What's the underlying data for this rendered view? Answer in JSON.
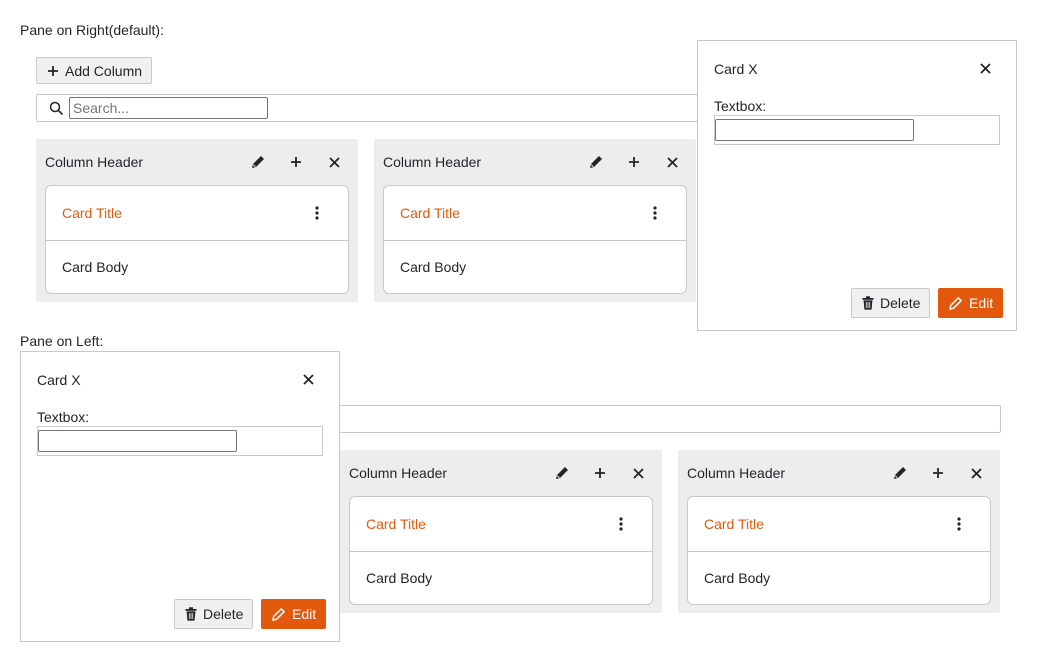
{
  "colors": {
    "accent": "#e3580c",
    "column_bg": "#ededed",
    "border": "#c9c9c9"
  },
  "icons": {
    "add": "plus-icon",
    "search": "search-icon",
    "edit": "pencil-icon",
    "close": "close-icon",
    "more": "kebab-icon",
    "delete": "trash-icon"
  },
  "right_demo": {
    "label": "Pane on Right(default):",
    "toolbar": {
      "add_column_label": "Add Column"
    },
    "search": {
      "placeholder": "Search...",
      "value": ""
    },
    "columns": [
      {
        "header": "Column Header",
        "cards": [
          {
            "title": "Card Title",
            "body": "Card Body"
          }
        ]
      },
      {
        "header": "Column Header",
        "cards": [
          {
            "title": "Card Title",
            "body": "Card Body"
          }
        ]
      }
    ],
    "pane": {
      "title": "Card X",
      "textbox_label": "Textbox:",
      "textbox_value": "",
      "delete_label": "Delete",
      "edit_label": "Edit"
    }
  },
  "left_demo": {
    "label": "Pane on Left:",
    "columns": [
      {
        "header": "Column Header",
        "cards": [
          {
            "title": "Card Title",
            "body": "Card Body"
          }
        ]
      },
      {
        "header": "Column Header",
        "cards": [
          {
            "title": "Card Title",
            "body": "Card Body"
          }
        ]
      }
    ],
    "pane": {
      "title": "Card X",
      "textbox_label": "Textbox:",
      "textbox_value": "",
      "delete_label": "Delete",
      "edit_label": "Edit"
    }
  }
}
